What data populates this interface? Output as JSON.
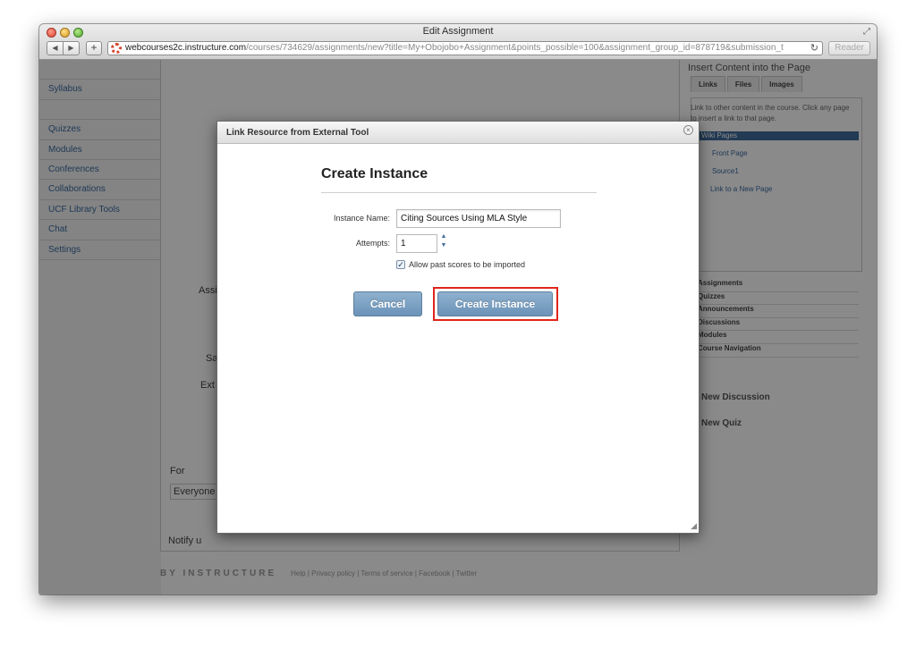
{
  "window": {
    "title": "Edit Assignment"
  },
  "browser": {
    "url_domain": "webcourses2c.instructure.com",
    "url_path": "/courses/734629/assignments/new?title=My+Obojobo+Assignment&points_possible=100&assignment_group_id=878719&submission_t",
    "reader_label": "Reader",
    "reload_icon": "reload-icon",
    "add_label": "+",
    "back_glyph": "◀",
    "forward_glyph": "▶"
  },
  "sidebar": {
    "items": [
      {
        "label": ""
      },
      {
        "label": "Syllabus"
      },
      {
        "label": ""
      },
      {
        "label": "Quizzes"
      },
      {
        "label": "Modules"
      },
      {
        "label": "Conferences"
      },
      {
        "label": "Collaborations"
      },
      {
        "label": "UCF Library Tools"
      },
      {
        "label": "Chat"
      },
      {
        "label": "Settings"
      }
    ]
  },
  "main": {
    "label_assign": "Assi",
    "label_sa": "Sa",
    "label_ext": "Ext",
    "label_for": "For",
    "label_everyone": "Everyone",
    "label_notify": "Notify u"
  },
  "footer": {
    "brand": "BY INSTRUCTURE",
    "links": "Help  |  Privacy policy  |  Terms of service  |  Facebook  |  Twitter"
  },
  "right_panel": {
    "title": "Insert Content into the Page",
    "tabs": [
      "Links",
      "Files",
      "Images"
    ],
    "description": "Link to other content in the course. Click any page to insert a link to that page.",
    "highlighted": "Wiki Pages",
    "link1": "Front Page",
    "link2": "Source1",
    "new_page": "Link to a New Page",
    "list": [
      "Assignments",
      "Quizzes",
      "Announcements",
      "Discussions",
      "Modules",
      "Course Navigation"
    ],
    "heading1": "New Discussion",
    "heading2": "New Quiz"
  },
  "dialog": {
    "title": "Link Resource from External Tool",
    "heading": "Create Instance",
    "instance_name_label": "Instance Name:",
    "instance_name_value": "Citing Sources Using MLA Style",
    "attempts_label": "Attempts:",
    "attempts_value": "1",
    "allow_past_label": "Allow past scores to be imported",
    "allow_past_checked": true,
    "cancel_label": "Cancel",
    "create_label": "Create Instance",
    "highlight_color": "#e0251b"
  }
}
